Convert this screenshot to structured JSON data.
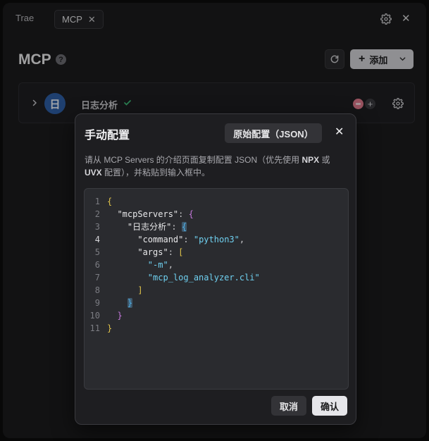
{
  "titlebar": {
    "app_tab": "Trae",
    "mcp_tab": "MCP",
    "tab_close": "✕",
    "close": "✕"
  },
  "header": {
    "title": "MCP",
    "help": "?",
    "add_label": "添加",
    "add_plus": "+"
  },
  "server": {
    "avatar": "日",
    "name": "日志分析",
    "plus": "+"
  },
  "dialog": {
    "title": "手动配置",
    "raw_button": "原始配置（JSON）",
    "close": "✕",
    "desc_parts": [
      "请从 MCP Servers 的介绍页面复制配置 JSON（优先使用 ",
      "NPX",
      " 或 ",
      "UVX",
      " 配置），并粘贴到输入框中。"
    ],
    "cancel": "取消",
    "confirm": "确认"
  },
  "editor": {
    "active_line": 4,
    "lines": [
      {
        "n": "1",
        "indent": "",
        "tokens": [
          {
            "t": "{",
            "c": "br-y"
          }
        ]
      },
      {
        "n": "2",
        "indent": "  ",
        "tokens": [
          {
            "t": "\"mcpServers\"",
            "c": "key"
          },
          {
            "t": ": ",
            "c": "punc"
          },
          {
            "t": "{",
            "c": "br-p"
          }
        ]
      },
      {
        "n": "3",
        "indent": "    ",
        "tokens": [
          {
            "t": "\"日志分析\"",
            "c": "key"
          },
          {
            "t": ": ",
            "c": "punc"
          },
          {
            "t": "{",
            "c": "br-b br-hl"
          }
        ]
      },
      {
        "n": "4",
        "indent": "      ",
        "tokens": [
          {
            "t": "\"command\"",
            "c": "key"
          },
          {
            "t": ": ",
            "c": "punc"
          },
          {
            "t": "\"python3\"",
            "c": "str"
          },
          {
            "t": ",",
            "c": "punc"
          }
        ]
      },
      {
        "n": "5",
        "indent": "      ",
        "tokens": [
          {
            "t": "\"args\"",
            "c": "key"
          },
          {
            "t": ": ",
            "c": "punc"
          },
          {
            "t": "[",
            "c": "br-y"
          }
        ]
      },
      {
        "n": "6",
        "indent": "        ",
        "tokens": [
          {
            "t": "\"-m\"",
            "c": "str"
          },
          {
            "t": ",",
            "c": "punc"
          }
        ]
      },
      {
        "n": "7",
        "indent": "        ",
        "tokens": [
          {
            "t": "\"mcp_log_analyzer.cli\"",
            "c": "str"
          }
        ]
      },
      {
        "n": "8",
        "indent": "      ",
        "tokens": [
          {
            "t": "]",
            "c": "br-y"
          }
        ]
      },
      {
        "n": "9",
        "indent": "    ",
        "tokens": [
          {
            "t": "}",
            "c": "br-b br-hl"
          }
        ]
      },
      {
        "n": "10",
        "indent": "  ",
        "tokens": [
          {
            "t": "}",
            "c": "br-p"
          }
        ]
      },
      {
        "n": "11",
        "indent": "",
        "tokens": [
          {
            "t": "}",
            "c": "br-y"
          }
        ]
      }
    ]
  },
  "colors": {
    "accent_avatar": "#2f5fa6",
    "success_check": "#3fbf7a",
    "badge_pink": "#e07a8c"
  }
}
